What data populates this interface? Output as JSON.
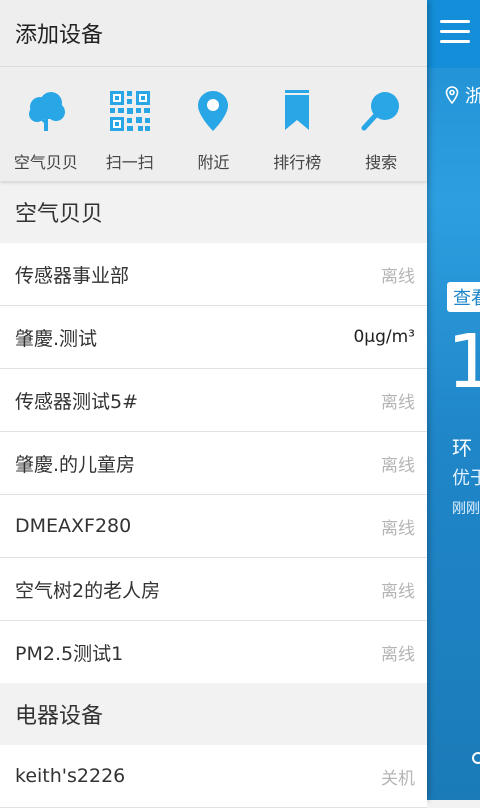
{
  "header": {
    "title": "添加设备"
  },
  "toolbar": {
    "items": [
      {
        "label": "空气贝贝",
        "icon": "cloud-tree-icon"
      },
      {
        "label": "扫一扫",
        "icon": "qr-code-icon"
      },
      {
        "label": "附近",
        "icon": "location-pin-icon"
      },
      {
        "label": "排行榜",
        "icon": "bookmark-icon"
      },
      {
        "label": "搜索",
        "icon": "search-icon"
      }
    ],
    "accent_color": "#28a6e6"
  },
  "sections": [
    {
      "title": "空气贝贝",
      "devices": [
        {
          "name": "传感器事业部",
          "status": "离线"
        },
        {
          "name": "肇慶.测试",
          "status": "0μg/m³"
        },
        {
          "name": "传感器测试5#",
          "status": "离线"
        },
        {
          "name": "肇慶.的儿童房",
          "status": "离线"
        },
        {
          "name": "DMEAXF280",
          "status": "离线"
        },
        {
          "name": "空气树2的老人房",
          "status": "离线"
        },
        {
          "name": "PM2.5测试1",
          "status": "离线"
        }
      ]
    },
    {
      "title": "电器设备",
      "devices": [
        {
          "name": "keith's2226",
          "status": "关机"
        }
      ]
    }
  ],
  "background_app": {
    "location": "浙",
    "check_button": "查看",
    "big_value": "1",
    "env_label": "环",
    "quality_label": "优于",
    "time_label": "刚刚"
  }
}
